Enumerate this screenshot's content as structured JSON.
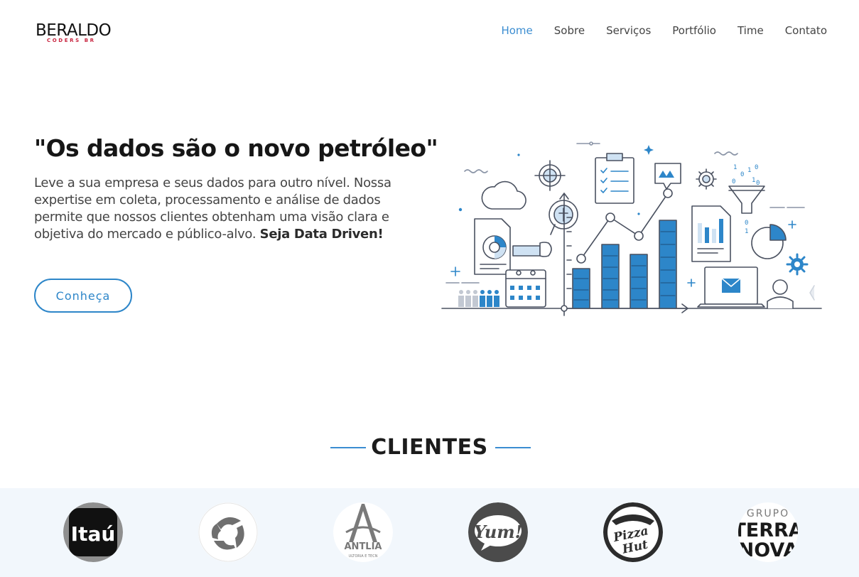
{
  "brand": {
    "name": "BERALDO",
    "tagline": "CODERS BR",
    "accent": "#c8243f"
  },
  "nav": {
    "items": [
      {
        "label": "Home",
        "active": true
      },
      {
        "label": "Sobre",
        "active": false
      },
      {
        "label": "Serviços",
        "active": false
      },
      {
        "label": "Portfólio",
        "active": false
      },
      {
        "label": "Time",
        "active": false
      },
      {
        "label": "Contato",
        "active": false
      }
    ],
    "active_color": "#3b8dd1"
  },
  "hero": {
    "title": "\"Os dados são o novo petróleo\"",
    "text": "Leve a sua empresa e seus dados para outro nível. Nossa expertise em coleta, processamento e análise de dados permite que nossos clientes obtenham uma visão clara e objetiva do mercado e público-alvo.",
    "text_bold": "Seja Data Driven!",
    "cta_label": "Conheça",
    "illustration": "data-analytics-illustration"
  },
  "clients": {
    "title": "CLIENTES",
    "logos": [
      {
        "name": "Itaú",
        "text": "Itaú"
      },
      {
        "name": "client-2-logo",
        "text": ""
      },
      {
        "name": "Antlia",
        "text": "ANTLIA",
        "subtext": "ULTORIA E TECN"
      },
      {
        "name": "Yum!",
        "text": "Yum!"
      },
      {
        "name": "Pizza Hut",
        "text_line1": "Pizza",
        "text_line2": "Hut"
      },
      {
        "name": "Grupo Terra Nova",
        "text_line1": "GRUPO",
        "text_line2": "TERRA",
        "text_line3": "NOVA"
      }
    ]
  },
  "colors": {
    "primary": "#2d86c9",
    "band_bg": "#f2f7fc",
    "title_text": "#161616"
  }
}
